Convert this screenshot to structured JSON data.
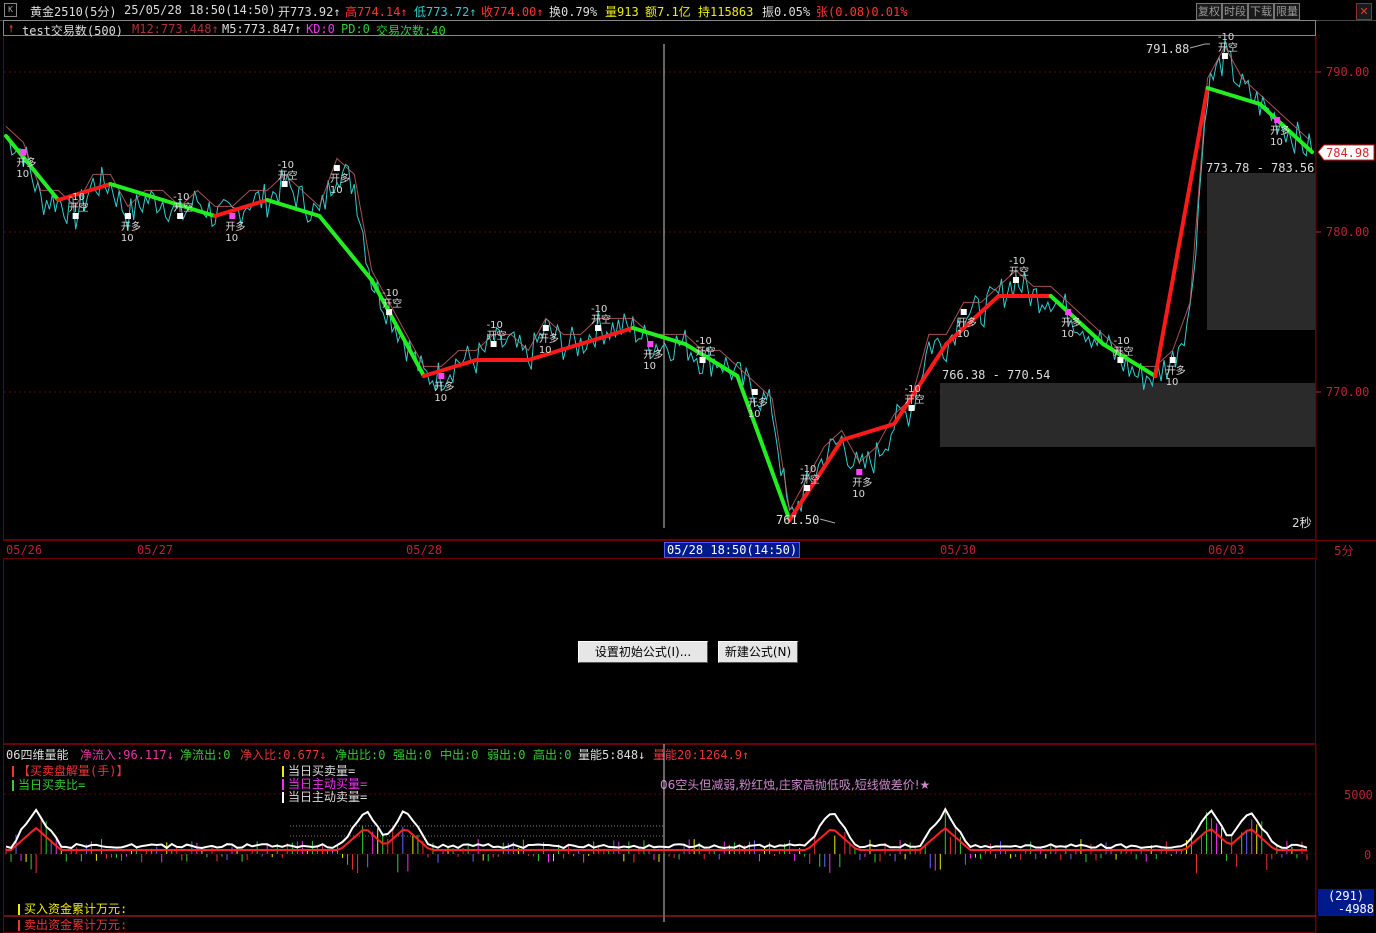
{
  "header": {
    "symbol": "黄金2510(5分)",
    "datetime": "25/05/28 18:50(14:50)",
    "open": "开773.92↑",
    "high": "高774.14↑",
    "low": "低773.72↑",
    "close": "收774.00↑",
    "turnover": "换0.79%",
    "volume": "量913",
    "amount": "额7.1亿",
    "position": "持115863",
    "amplitude": "振0.05%",
    "change": "张(0.08)0.01%",
    "buttons": [
      "复权",
      "时段",
      "下载",
      "限量"
    ]
  },
  "indicator_line": {
    "name": "test交易数(500)",
    "m12": "M12:773.448↑",
    "m5": "M5:773.847↑",
    "kd": "KD:0",
    "pd": "PD:0",
    "trade_count": "交易次数:40"
  },
  "main_chart": {
    "y_ticks": [
      "790.00",
      "780.00",
      "770.00"
    ],
    "current_price": "784.98",
    "high_label": "791.88",
    "low_label": "761.50",
    "range1": "773.78 - 783.56",
    "range2": "766.38 - 770.54",
    "timer": "2秒",
    "signal_open": "开多",
    "signal_close": "开空",
    "signal_num": "10",
    "signal_neg": "-10"
  },
  "chart_data": {
    "type": "line",
    "series": [
      {
        "values": [
          786,
          785,
          782,
          782,
          781,
          783,
          783,
          781,
          782,
          782,
          781,
          782,
          781,
          781,
          782,
          782,
          783,
          782,
          781,
          784,
          783,
          777,
          775,
          773,
          771,
          771,
          772,
          772,
          773,
          773,
          772,
          774,
          773,
          773,
          774,
          774,
          774,
          773,
          773,
          773,
          772,
          772,
          771,
          770,
          769,
          762,
          764,
          766,
          767,
          765,
          766,
          768,
          769,
          773,
          773,
          775,
          775,
          776,
          777,
          776,
          776,
          775,
          774,
          773,
          772,
          771,
          771,
          772,
          775,
          789,
          791,
          789,
          788,
          787,
          786,
          785
        ]
      }
    ],
    "ylim": [
      758,
      793
    ]
  },
  "time_axis": {
    "dates": [
      "05/26",
      "05/27",
      "05/28",
      "05/30",
      "06/03"
    ],
    "cursor": "05/28 18:50(14:50)",
    "period": "5分"
  },
  "middle": {
    "button1": "设置初始公式(I)...",
    "button2": "新建公式(N)"
  },
  "lower": {
    "title": "06四维量能",
    "net_in": "净流入:96.117↓",
    "net_out": "净流出:0",
    "net_in_ratio": "净入比:0.677↓",
    "net_out_ratio": "净出比:0",
    "strong_out": "强出:0",
    "mid_out": "中出:0",
    "weak_out": "弱出:0",
    "high_out": "高出:0",
    "vol5": "量能5:848↓",
    "vol20": "量能20:1264.9↑",
    "legend_buy_sell": "【买卖盘解量(手)】",
    "legend_ratio": "当日买卖比=",
    "legend_vol": "当日买卖量=",
    "legend_active_buy": "当日主动买量=",
    "legend_active_sell": "当日主动卖量=",
    "note": "06空头但减弱,粉红烛,庄家高抛低吸,短线做差价!★",
    "y_ticks": [
      "5000",
      "0"
    ],
    "value_box1": "(291)",
    "value_box2": "-4988",
    "buy_cum": "买入资金累计万元:",
    "sell_cum": "卖出资金累计万元:"
  }
}
